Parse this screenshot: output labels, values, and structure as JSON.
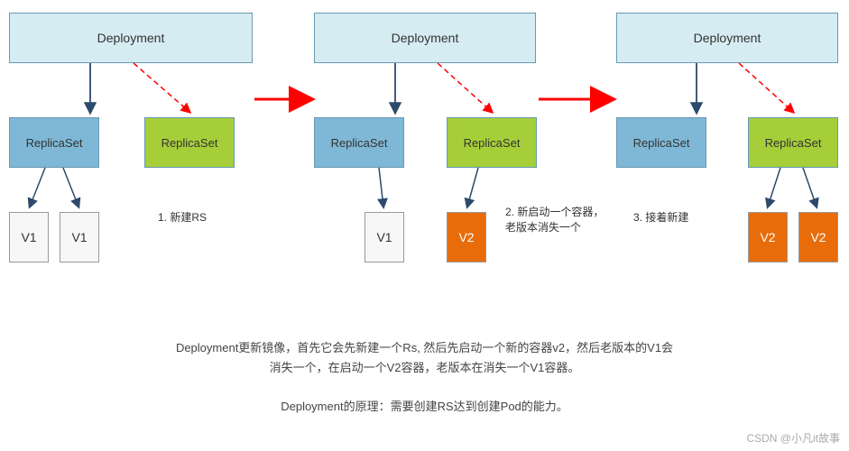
{
  "boxes": {
    "deployment": "Deployment",
    "replicaset": "ReplicaSet",
    "v1": "V1",
    "v2": "V2"
  },
  "notes": {
    "n1": "1. 新建RS",
    "n2_line1": "2. 新启动一个容器，",
    "n2_line2": "老版本消失一个",
    "n3": "3. 接着新建"
  },
  "bottom": {
    "p1": "Deployment更新镜像，首先它会先新建一个Rs, 然后先启动一个新的容器v2，然后老版本的V1会",
    "p2": "消失一个，在启动一个V2容器，老版本在消失一个V1容器。",
    "p3": "Deployment的原理：需要创建RS达到创建Pod的能力。"
  },
  "watermark": "CSDN @小凡it故事"
}
